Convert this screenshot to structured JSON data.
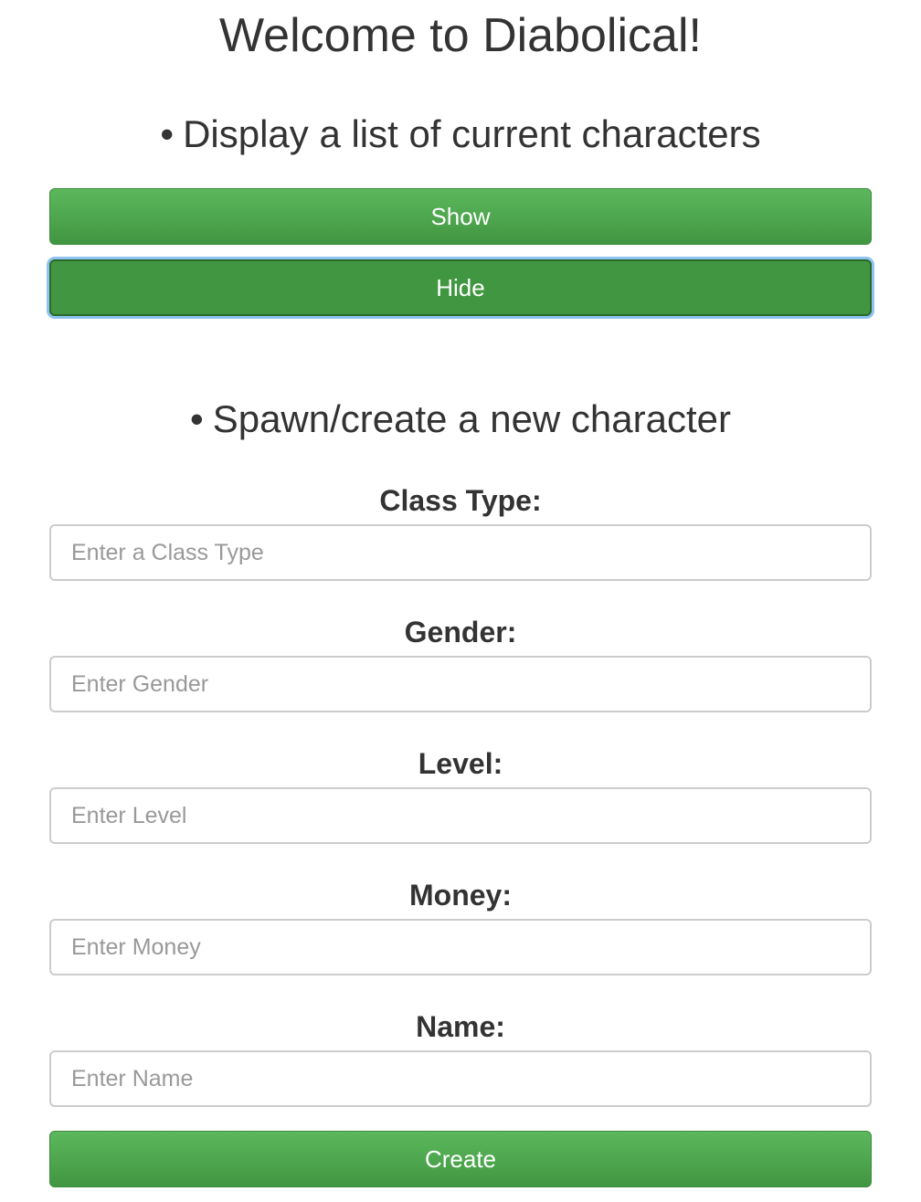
{
  "page": {
    "title": "Welcome to Diabolical!"
  },
  "display_section": {
    "bullet": "•",
    "heading": "Display a list of current characters",
    "show_label": "Show",
    "hide_label": "Hide"
  },
  "spawn_section": {
    "bullet": "•",
    "heading": "Spawn/create a new character",
    "fields": [
      {
        "label": "Class Type:",
        "placeholder": "Enter a Class Type",
        "value": ""
      },
      {
        "label": "Gender:",
        "placeholder": "Enter Gender",
        "value": ""
      },
      {
        "label": "Level:",
        "placeholder": "Enter Level",
        "value": ""
      },
      {
        "label": "Money:",
        "placeholder": "Enter Money",
        "value": ""
      },
      {
        "label": "Name:",
        "placeholder": "Enter Name",
        "value": ""
      }
    ],
    "create_label": "Create"
  },
  "colors": {
    "button_green": "#5cb85c",
    "button_green_dark": "#419641",
    "focus_ring": "#8ec2f0",
    "text": "#333333",
    "placeholder": "#999999",
    "input_border": "#cccccc"
  }
}
